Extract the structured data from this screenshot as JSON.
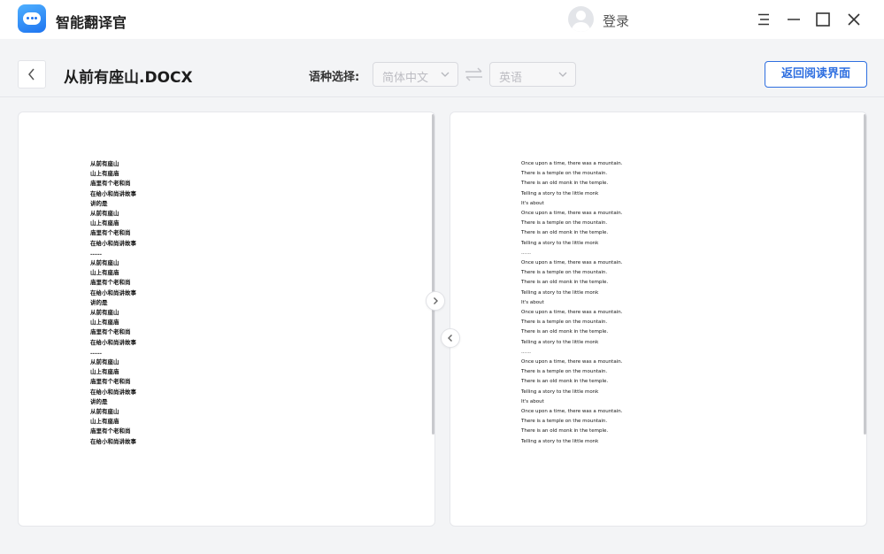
{
  "app": {
    "name": "智能翻译官",
    "login_label": "登录"
  },
  "toolbar": {
    "doc_title": "从前有座山.DOCX",
    "lang_label": "语种选择:",
    "source_lang": "简体中文",
    "target_lang": "英语",
    "return_label": "返回阅读界面"
  },
  "source_lines": [
    "从前有座山",
    "山上有座庙",
    "庙里有个老和尚",
    "在给小和尚讲故事",
    "讲的是",
    "从前有座山",
    "山上有座庙",
    "庙里有个老和尚",
    "在给小和尚讲故事",
    "……",
    "从前有座山",
    "山上有座庙",
    "庙里有个老和尚",
    "在给小和尚讲故事",
    "讲的是",
    "从前有座山",
    "山上有座庙",
    "庙里有个老和尚",
    "在给小和尚讲故事",
    "……",
    "从前有座山",
    "山上有座庙",
    "庙里有个老和尚",
    "在给小和尚讲故事",
    "讲的是",
    "从前有座山",
    "山上有座庙",
    "庙里有个老和尚",
    "在给小和尚讲故事"
  ],
  "translated_lines": [
    "Once upon a time, there was a mountain.",
    "There is a temple on the mountain.",
    "There is an old monk in the temple.",
    "Telling a story to the little monk",
    "It's about",
    "Once upon a time, there was a mountain.",
    "There is a temple on the mountain.",
    "There is an old monk in the temple.",
    "Telling a story to the little monk",
    "……",
    "Once upon a time, there was a mountain.",
    "There is a temple on the mountain.",
    "There is an old monk in the temple.",
    "Telling a story to the little monk",
    "It's about",
    "Once upon a time, there was a mountain.",
    "There is a temple on the mountain.",
    "There is an old monk in the temple.",
    "Telling a story to the little monk",
    "……",
    "Once upon a time, there was a mountain.",
    "There is a temple on the mountain.",
    "There is an old monk in the temple.",
    "Telling a story to the little monk",
    "It's about",
    "Once upon a time, there was a mountain.",
    "There is a temple on the mountain.",
    "There is an old monk in the temple.",
    "Telling a story to the little monk"
  ],
  "icons": {
    "logo": "robot-logo-icon",
    "avatar": "user-avatar-icon",
    "menu": "menu-icon",
    "minimize": "minimize-icon",
    "maximize": "maximize-icon",
    "close": "close-icon",
    "back": "chevron-left-icon",
    "swap": "swap-arrows-icon",
    "dropdown": "chevron-down-icon",
    "next": "chevron-right-icon",
    "prev": "chevron-left-icon"
  },
  "colors": {
    "accent": "#2f6fe0",
    "background": "#f3f4f6",
    "logo": "#1e74f0"
  }
}
